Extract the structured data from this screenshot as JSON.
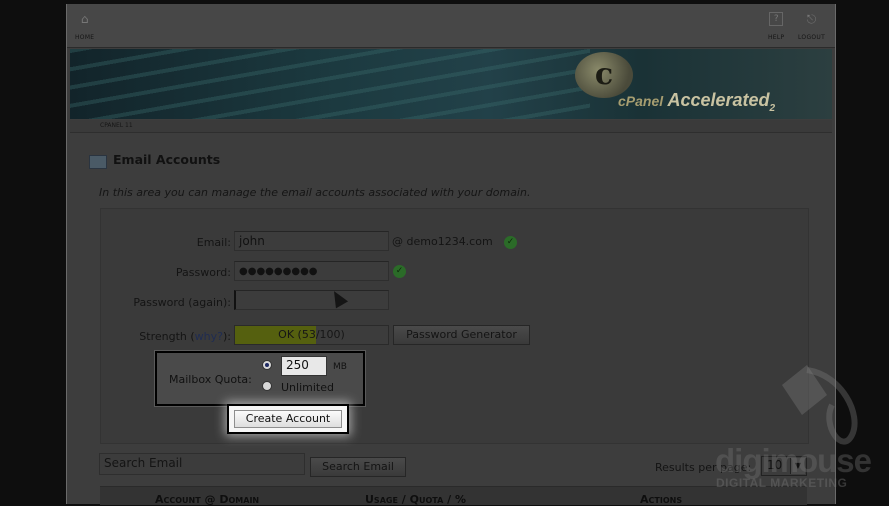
{
  "topbar": {
    "home_label": "HOME",
    "help_label": "HELP",
    "logout_label": "LOGOUT"
  },
  "banner": {
    "logo_letter": "c",
    "brand": "cPanel",
    "product": "Accelerated",
    "version": "2"
  },
  "breadcrumb": "CPANEL 11",
  "page": {
    "title": "Email Accounts",
    "description": "In this area you can manage the email accounts associated with your domain."
  },
  "form": {
    "email_label": "Email:",
    "email_value": "john",
    "domain": "@ demo1234.com",
    "password_label": "Password:",
    "password_value": "●●●●●●●●●",
    "password_again_label": "Password (again):",
    "password_again_value": "",
    "strength_label": "Strength (",
    "strength_link": "why?",
    "strength_label_end": "):",
    "strength_value": "OK (53/100)",
    "strength_fraction": 0.53,
    "generator_button": "Password Generator",
    "quota_label": "Mailbox Quota:",
    "quota_value": "250",
    "quota_unit": "MB",
    "unlimited_label": "Unlimited",
    "create_button": "Create Account"
  },
  "search": {
    "placeholder": "Search Email",
    "button": "Search Email",
    "results_label": "Results per page:",
    "results_value": "10"
  },
  "table": {
    "headers": [
      "Account @ Domain",
      "Usage / Quota / %",
      "Actions"
    ]
  },
  "watermark": {
    "brand": "digimouse",
    "sub": "DIGITAL MARKETING"
  },
  "colors": {
    "strength_fill": "#55600f",
    "ok_icon": "#2b6b28"
  }
}
